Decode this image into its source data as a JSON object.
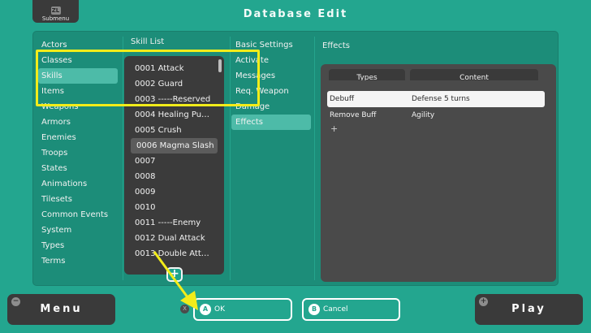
{
  "topButton": {
    "badge": "ZL",
    "label": "Submenu"
  },
  "title": "Database Edit",
  "categories": {
    "items": [
      "Actors",
      "Classes",
      "Skills",
      "Items",
      "Weapons",
      "Armors",
      "Enemies",
      "Troops",
      "States",
      "Animations",
      "Tilesets",
      "Common Events",
      "System",
      "Types",
      "Terms"
    ],
    "selected": 2
  },
  "skillList": {
    "header": "Skill List",
    "items": [
      "0001 Attack",
      "0002 Guard",
      "0003 -----Reserved",
      "0004 Healing Pu…",
      "0005 Crush",
      "0006 Magma Slash",
      "0007",
      "0008",
      "0009",
      "0010",
      "0011 -----Enemy",
      "0012 Dual Attack",
      "0013 Double Att…"
    ],
    "selected": 5,
    "addButton": "+"
  },
  "settingsNav": {
    "items": [
      "Basic Settings",
      "Activate",
      "Messages",
      "Req. Weapon",
      "Damage",
      "Effects"
    ],
    "selected": 5
  },
  "effects": {
    "header": "Effects",
    "columns": {
      "types": "Types",
      "content": "Content"
    },
    "rows": [
      {
        "type": "Debuff",
        "content": "Defense 5 turns"
      },
      {
        "type": "Remove Buff",
        "content": "Agility"
      }
    ],
    "addRow": "+"
  },
  "bottomBar": {
    "menu": {
      "icon": "−",
      "label": "Menu"
    },
    "play": {
      "icon": "+",
      "label": "Play"
    },
    "xIcon": "X",
    "ok": {
      "icon": "A",
      "label": "OK"
    },
    "cancel": {
      "icon": "B",
      "label": "Cancel"
    }
  },
  "colors": {
    "background": "#23a68f",
    "panel": "#3b3b3b",
    "highlight": "#f2ec1a"
  }
}
